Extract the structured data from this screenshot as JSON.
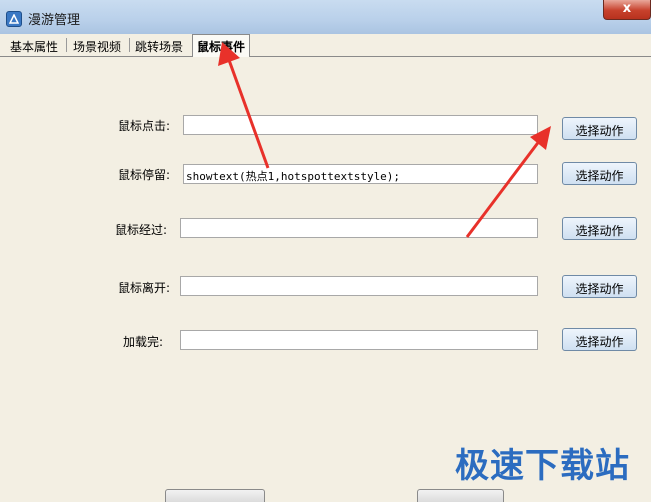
{
  "window": {
    "title": "漫游管理",
    "close_glyph": "x"
  },
  "tabs": [
    {
      "label": "基本属性"
    },
    {
      "label": "场景视频"
    },
    {
      "label": "跳转场景"
    },
    {
      "label": "鼠标事件"
    }
  ],
  "fields": [
    {
      "label": "鼠标点击:",
      "value": "",
      "button": "选择动作"
    },
    {
      "label": "鼠标停留:",
      "value": "showtext(热点1,hotspottextstyle);",
      "button": "选择动作"
    },
    {
      "label": "鼠标经过:",
      "value": "",
      "button": "选择动作"
    },
    {
      "label": "鼠标离开:",
      "value": "",
      "button": "选择动作"
    },
    {
      "label": "加载完:",
      "value": "",
      "button": "选择动作"
    }
  ],
  "watermark": "极速下载站",
  "colors": {
    "arrow": "#e8312a",
    "watermark": "#2b6cc0"
  }
}
